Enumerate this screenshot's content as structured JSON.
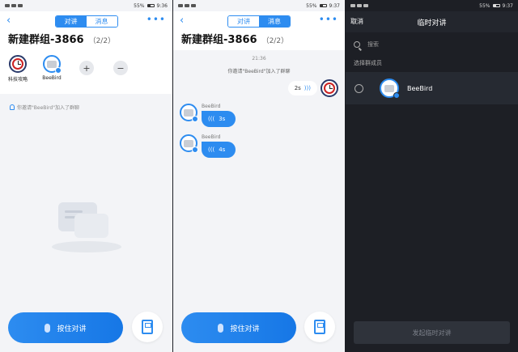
{
  "panel1": {
    "status": {
      "battery": "55%",
      "time": "9:36"
    },
    "tabs": [
      "对讲",
      "消息"
    ],
    "active_tab": 0,
    "title": "新建群组-3866",
    "count": "（2/2）",
    "members": [
      {
        "name": "科技攻略",
        "type": "clock"
      },
      {
        "name": "BeeBird",
        "type": "device"
      }
    ],
    "add_label": "+",
    "remove_label": "−",
    "notice": "你邀请\"BeeBird\"加入了群聊",
    "ptt_label": "按住对讲"
  },
  "panel2": {
    "status": {
      "battery": "55%",
      "time": "9:37"
    },
    "tabs": [
      "对讲",
      "消息"
    ],
    "active_tab": 1,
    "title": "新建群组-3866",
    "count": "（2/2）",
    "timestamp": "21:36",
    "system_message": "你邀请\"BeeBird\"加入了群聊",
    "outgoing": {
      "duration": "2s"
    },
    "incoming": [
      {
        "sender": "BeeBird",
        "duration": "3s"
      },
      {
        "sender": "BeeBird",
        "duration": "4s"
      }
    ],
    "ptt_label": "按住对讲"
  },
  "panel3": {
    "status": {
      "battery": "55%",
      "time": "9:37"
    },
    "cancel_label": "取消",
    "title": "临时对讲",
    "search_placeholder": "搜索",
    "section_label": "选择群成员",
    "member": {
      "name": "BeeBird"
    },
    "start_label": "发起临时对讲"
  },
  "colors": {
    "accent": "#2d8cf0",
    "dark_bg": "#1d1f25"
  }
}
